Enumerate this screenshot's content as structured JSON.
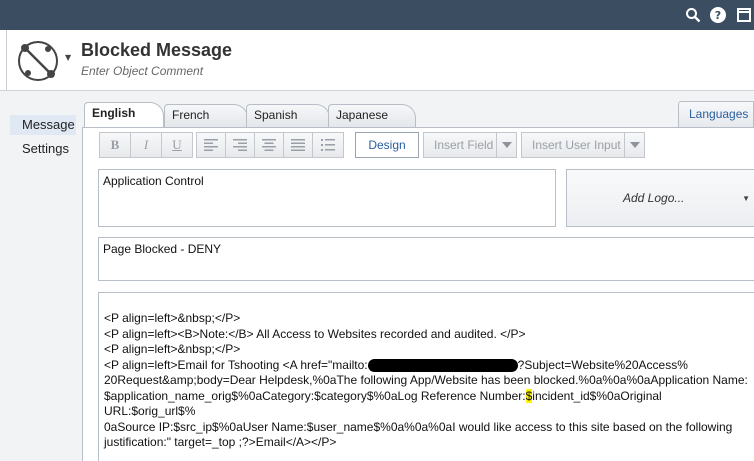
{
  "titlebar": {
    "icons": [
      "search-icon",
      "help-icon",
      "maximize-icon"
    ],
    "help_glyph": "?"
  },
  "header": {
    "title": "Blocked Message",
    "comment_placeholder": "Enter Object Comment",
    "icon": "blocked-message-object-icon"
  },
  "sidebar": {
    "items": [
      {
        "label": "Message",
        "active": true
      },
      {
        "label": "Settings",
        "active": false
      }
    ]
  },
  "tabs": [
    {
      "label": "English",
      "active": true
    },
    {
      "label": "French",
      "active": false
    },
    {
      "label": "Spanish",
      "active": false
    },
    {
      "label": "Japanese",
      "active": false
    }
  ],
  "languages_button": "Languages",
  "toolbar": {
    "bold": "B",
    "italic": "I",
    "underline": "U",
    "align_icons": [
      "align-left-icon",
      "align-right-icon",
      "align-center-icon",
      "align-justify-icon",
      "bullet-list-icon"
    ],
    "design": "Design",
    "insert_field": "Insert Field",
    "insert_user_input": "Insert User Input"
  },
  "fields": {
    "title_value": "Application Control",
    "add_logo": "Add Logo...",
    "subtitle_value": "Page Blocked - DENY"
  },
  "body_html": {
    "line1": "<P align=left>&nbsp;</P>",
    "line2": "<P align=left><B>Note:</B> All Access to Websites recorded and audited. </P>",
    "line3": "<P align=left>&nbsp;</P>",
    "line4_a": "<P align=left>Email for Tshooting <A href=\"mailto:",
    "line4_b": "?Subject=Website%20Access%",
    "line5": "20Request&amp;body=Dear Helpdesk,%0aThe following App/Website has been blocked.%0a%0a%0aApplication Name:",
    "line6": "$application_name_orig$%0aCategory:$category$%0aLog Reference Number:",
    "line6_hl": "$",
    "line6_b": "incident_id$%0aOriginal URL:$orig_url$%",
    "line7": "0aSource IP:$src_ip$%0aUser Name:$user_name$%0a%0a%0aI would like access to this site based on the following",
    "line8": "justification:\" target=_top ;?>Email</A></P>"
  },
  "colors": {
    "titlebar": "#3b4d60",
    "accent": "#2a5fa0",
    "highlight": "#fff200"
  }
}
